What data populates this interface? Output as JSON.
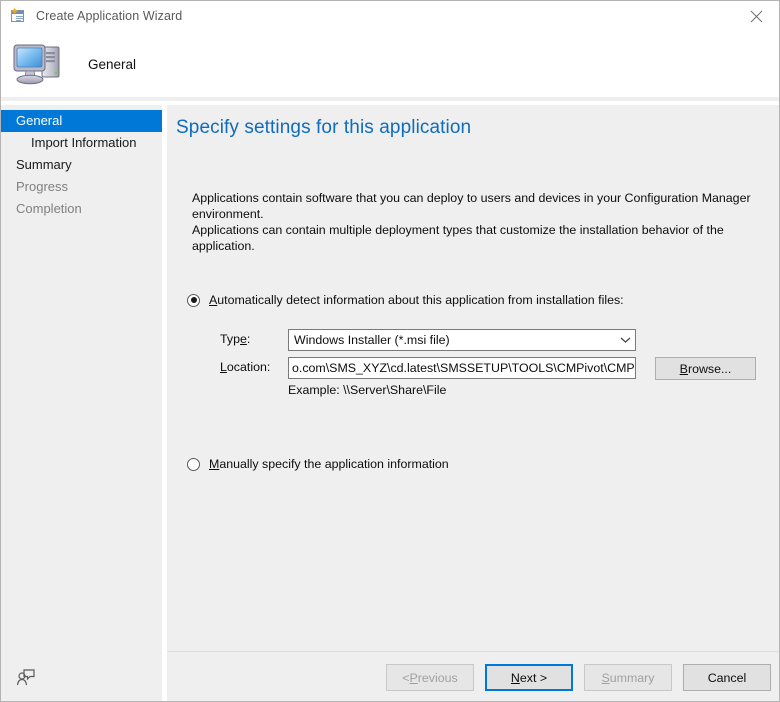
{
  "window": {
    "title": "Create Application Wizard",
    "title_icon": "new-window-icon",
    "close_icon": "close-icon"
  },
  "header": {
    "title": "General",
    "icon": "computer-icon"
  },
  "sidebar": {
    "items": [
      {
        "label": "General",
        "state": "active",
        "indent": false
      },
      {
        "label": "Import Information",
        "state": "normal",
        "indent": true
      },
      {
        "label": "Summary",
        "state": "normal",
        "indent": false
      },
      {
        "label": "Progress",
        "state": "dim",
        "indent": false
      },
      {
        "label": "Completion",
        "state": "dim",
        "indent": false
      }
    ]
  },
  "main": {
    "page_title": "Specify settings for this application",
    "intro_line1": "Applications contain software that you can deploy to users and devices in your Configuration Manager environment.",
    "intro_line2": "Applications can contain multiple deployment types that customize the installation behavior of the application.",
    "options": {
      "automatic": {
        "accelerator": "A",
        "label_rest": "utomatically detect information about this application from installation files:",
        "selected": true
      },
      "manual": {
        "accelerator": "M",
        "label_rest": "anually specify the application information",
        "selected": false
      }
    },
    "type_field": {
      "label_pre": "Typ",
      "label_accelerator": "e",
      "label_post": ":",
      "value": "Windows Installer (*.msi file)",
      "arrow_icon": "chevron-down-icon"
    },
    "location_field": {
      "label_accelerator": "L",
      "label_rest": "ocation:",
      "value": "o.com\\SMS_XYZ\\cd.latest\\SMSSETUP\\TOOLS\\CMPivot\\CMPivot.msi",
      "browse_accelerator": "B",
      "browse_rest": "rowse...",
      "example": "Example: \\\\Server\\Share\\File"
    }
  },
  "footer": {
    "feedback_icon": "feedback-person-icon",
    "buttons": [
      {
        "pre": "< ",
        "accelerator": "P",
        "post": "revious",
        "state": "disabled"
      },
      {
        "pre": "",
        "accelerator": "N",
        "post": "ext >",
        "state": "focused"
      },
      {
        "pre": "",
        "accelerator": "S",
        "post": "ummary",
        "state": "disabled"
      },
      {
        "pre": "",
        "accelerator": "",
        "post": "Cancel",
        "state": "normal"
      }
    ]
  },
  "colors": {
    "accent_blue": "#0078d7",
    "title_blue": "#0f6cbd",
    "panel_gray": "#efefef",
    "button_gray": "#e1e1e1"
  }
}
